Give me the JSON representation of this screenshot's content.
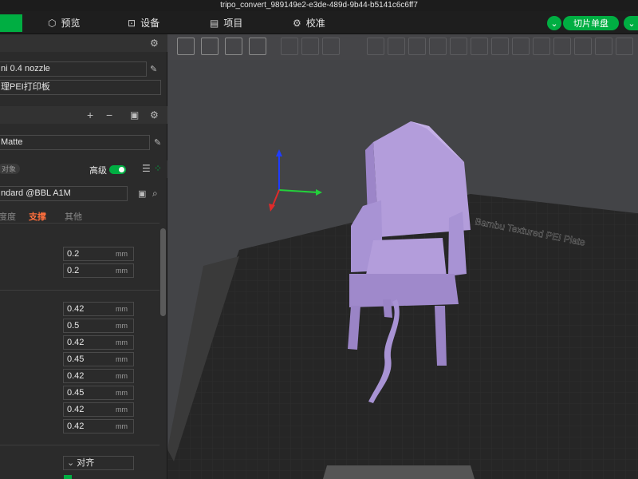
{
  "window": {
    "title": "tripo_convert_989149e2-e3de-489d-9b44-b5141c6c6ff7"
  },
  "topbar": {
    "tabs": [
      {
        "label": "预览",
        "icon": "cube-icon"
      },
      {
        "label": "设备",
        "icon": "device-icon"
      },
      {
        "label": "项目",
        "icon": "project-icon"
      },
      {
        "label": "校准",
        "icon": "calibrate-icon"
      }
    ],
    "slice_button": "切片单盘"
  },
  "sidebar": {
    "printer": {
      "nozzle": "ni 0.4 nozzle",
      "plate": "理PEI打印板"
    },
    "filament": {
      "name": "Matte"
    },
    "process": {
      "object_tag": "对象",
      "advanced_label": "高级",
      "advanced_on": true,
      "preset": "ndard @BBL A1M",
      "tabs": [
        "度度",
        "支撑",
        "其他"
      ],
      "active_tab": "支撑"
    },
    "values": [
      {
        "value": "0.2",
        "unit": "mm"
      },
      {
        "value": "0.2",
        "unit": "mm"
      },
      {
        "value": "0.42",
        "unit": "mm"
      },
      {
        "value": "0.5",
        "unit": "mm"
      },
      {
        "value": "0.42",
        "unit": "mm"
      },
      {
        "value": "0.45",
        "unit": "mm"
      },
      {
        "value": "0.42",
        "unit": "mm"
      },
      {
        "value": "0.45",
        "unit": "mm"
      },
      {
        "value": "0.42",
        "unit": "mm"
      },
      {
        "value": "0.42",
        "unit": "mm"
      }
    ],
    "align_select": "对齐"
  },
  "viewport": {
    "plate_label": "Bambu Textured PEI Plate",
    "model_color": "#b39ddb",
    "accent": "#00ae42"
  }
}
